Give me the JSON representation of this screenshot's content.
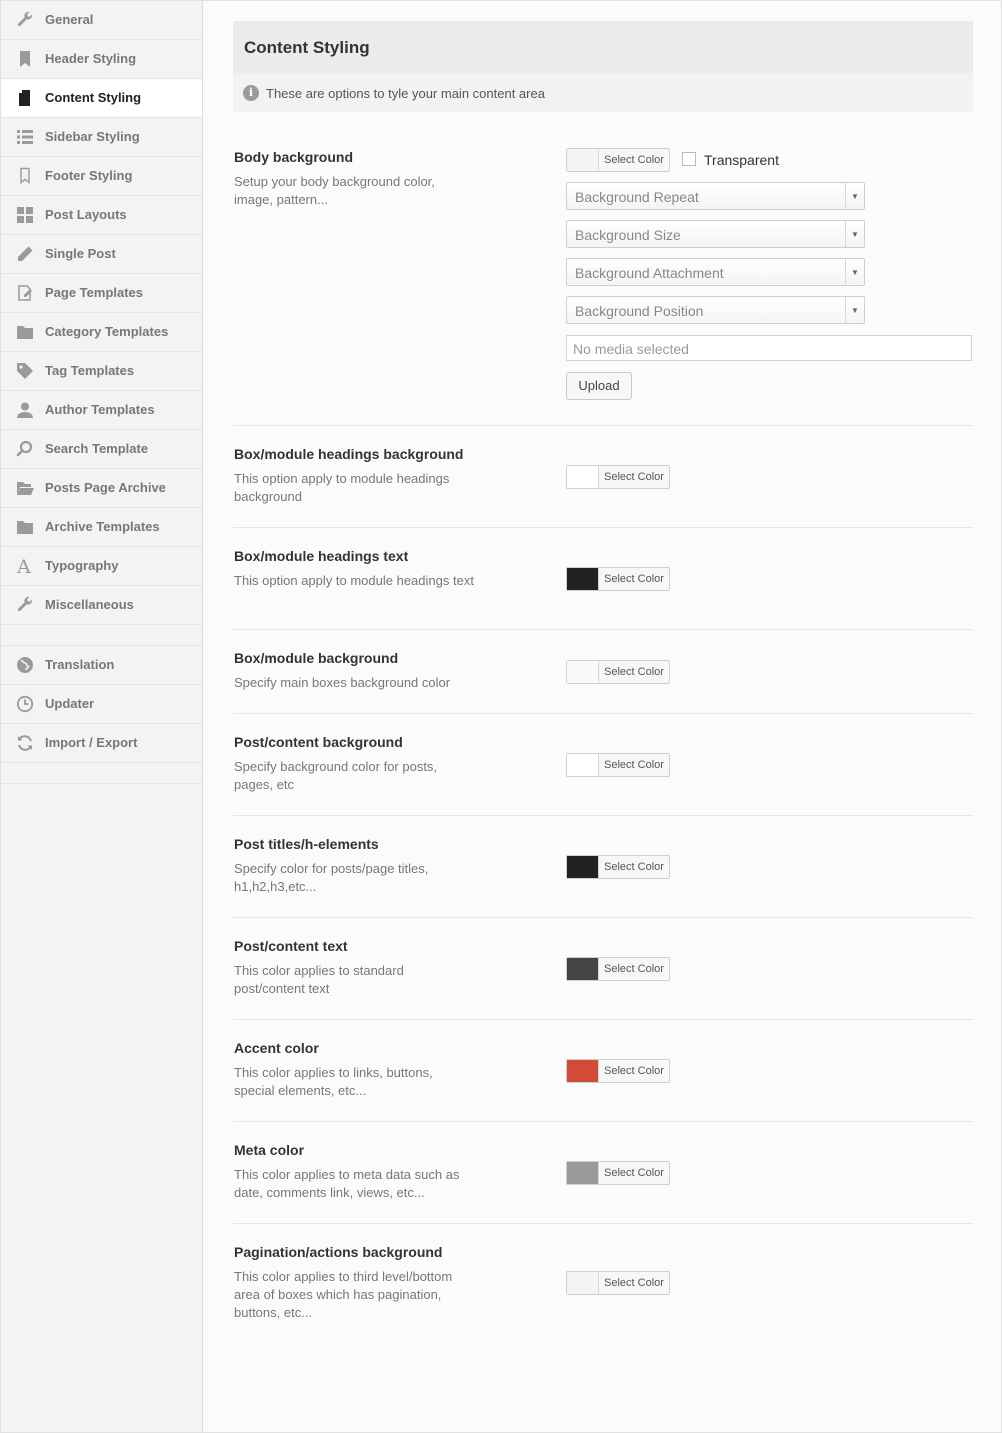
{
  "sidebar": {
    "items": [
      {
        "label": "General",
        "icon": "wrench-icon",
        "active": false
      },
      {
        "label": "Header Styling",
        "icon": "bookmark-icon",
        "active": false
      },
      {
        "label": "Content Styling",
        "icon": "document-icon",
        "active": true
      },
      {
        "label": "Sidebar Styling",
        "icon": "list-icon",
        "active": false
      },
      {
        "label": "Footer Styling",
        "icon": "bookmark-outline-icon",
        "active": false
      },
      {
        "label": "Post Layouts",
        "icon": "grid-icon",
        "active": false
      },
      {
        "label": "Single Post",
        "icon": "pencil-icon",
        "active": false
      },
      {
        "label": "Page Templates",
        "icon": "edit-page-icon",
        "active": false
      },
      {
        "label": "Category Templates",
        "icon": "folder-icon",
        "active": false
      },
      {
        "label": "Tag Templates",
        "icon": "tag-icon",
        "active": false
      },
      {
        "label": "Author Templates",
        "icon": "user-icon",
        "active": false
      },
      {
        "label": "Search Template",
        "icon": "search-icon",
        "active": false
      },
      {
        "label": "Posts Page Archive",
        "icon": "folder-open-icon",
        "active": false
      },
      {
        "label": "Archive Templates",
        "icon": "folder-icon",
        "active": false
      },
      {
        "label": "Typography",
        "icon": "font-icon",
        "active": false
      },
      {
        "label": "Miscellaneous",
        "icon": "wrench-icon",
        "active": false
      }
    ],
    "items2": [
      {
        "label": "Translation",
        "icon": "globe-icon"
      },
      {
        "label": "Updater",
        "icon": "clock-icon"
      },
      {
        "label": "Import / Export",
        "icon": "refresh-icon"
      }
    ]
  },
  "panel": {
    "title": "Content Styling",
    "info": "These are options to tyle your main content area"
  },
  "select_color_label": "Select Color",
  "body_background": {
    "title": "Body background",
    "desc": "Setup your body background color, image, pattern...",
    "swatch": "#f4f4f4",
    "transparent_label": "Transparent",
    "selects": [
      "Background Repeat",
      "Background Size",
      "Background Attachment",
      "Background Position"
    ],
    "media_placeholder": "No media selected",
    "upload_label": "Upload"
  },
  "options": [
    {
      "title": "Box/module headings background",
      "desc": "This option apply to module headings background",
      "swatch": "#ffffff"
    },
    {
      "title": "Box/module headings text",
      "desc": "This option apply to module headings text",
      "swatch": "#222222"
    },
    {
      "title": "Box/module background",
      "desc": "Specify main boxes background color",
      "swatch": "#fafafa"
    },
    {
      "title": "Post/content background",
      "desc": "Specify background color for posts, pages, etc",
      "swatch": "#ffffff"
    },
    {
      "title": "Post titles/h-elements",
      "desc": "Specify color for posts/page titles, h1,h2,h3,etc...",
      "swatch": "#222222"
    },
    {
      "title": "Post/content text",
      "desc": "This color applies to standard post/content text",
      "swatch": "#444444"
    },
    {
      "title": "Accent color",
      "desc": "This color applies to links, buttons, special elements, etc...",
      "swatch": "#d24b36"
    },
    {
      "title": "Meta color",
      "desc": "This color applies to meta data such as date, comments link, views, etc...",
      "swatch": "#999999"
    },
    {
      "title": "Pagination/actions background",
      "desc": "This color applies to third level/bottom area of boxes which has pagination, buttons, etc...",
      "swatch": "#f4f4f4"
    }
  ]
}
